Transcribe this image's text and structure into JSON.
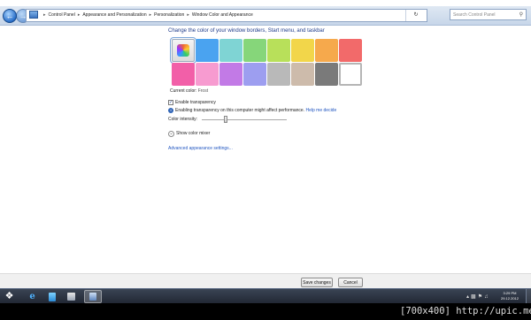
{
  "address_bar": {
    "breadcrumbs": [
      "Control Panel",
      "Appearance and Personalization",
      "Personalization",
      "Window Color and Appearance"
    ],
    "search_placeholder": "Search Control Panel"
  },
  "page": {
    "heading": "Change the color of your window borders, Start menu, and taskbar",
    "swatches_row1": [
      "#6a5acd",
      "#4aa3f0",
      "#7fd4d4",
      "#86d67a",
      "#b8e05a",
      "#f2d64a",
      "#f6a94c",
      "#f26a6a"
    ],
    "swatches_row2": [
      "#f25fa8",
      "#f79bd0",
      "#c27ae6",
      "#9d9ef0",
      "#b9b9b9",
      "#cdbbab",
      "#7a7a7a",
      "#ffffff"
    ],
    "current_color_label": "Current color:",
    "current_color_value": "Frost",
    "enable_transparency_label": "Enable transparency",
    "enable_transparency_checked": true,
    "transparency_info": "Enabling transparency on this computer might affect performance.",
    "help_link": "Help me decide",
    "intensity_label": "Color intensity:",
    "intensity_level": 0.28,
    "color_mixer_label": "Show color mixer",
    "advanced_link": "Advanced appearance settings..."
  },
  "footer": {
    "save_label": "Save changes",
    "cancel_label": "Cancel"
  },
  "taskbar": {
    "time": "3:29 PM",
    "date": "29.12.2012"
  },
  "watermark": "[700x400] http://upic.me/"
}
